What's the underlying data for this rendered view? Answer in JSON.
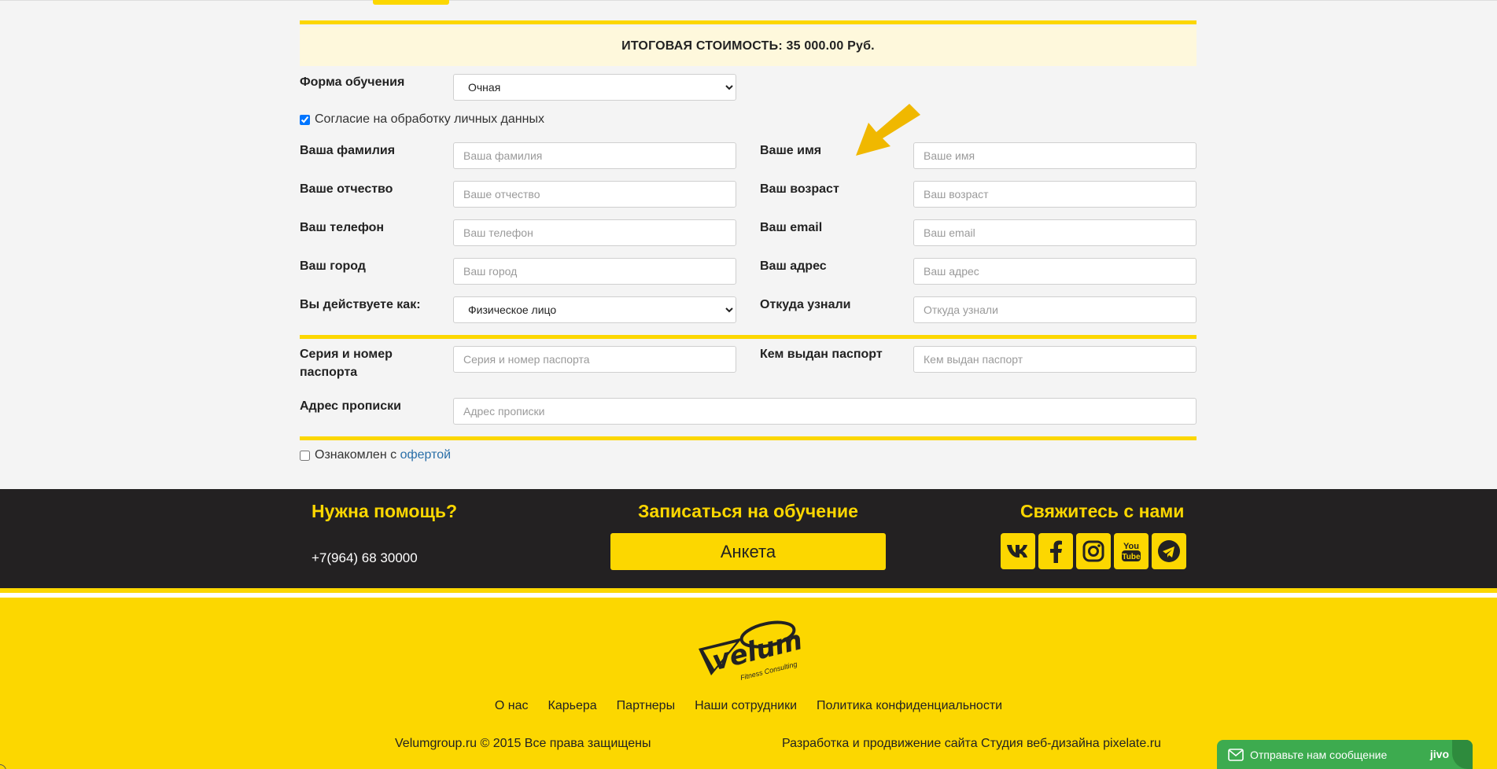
{
  "total": {
    "label": "ИТОГОВАЯ СТОИМОСТЬ: 35 000.00 Руб."
  },
  "form": {
    "study_form": {
      "label": "Форма обучения",
      "value": "Очная"
    },
    "consent": {
      "label": "Согласие на обработку личных данных",
      "checked": true
    },
    "surname": {
      "label": "Ваша фамилия",
      "placeholder": "Ваша фамилия"
    },
    "name": {
      "label": "Ваше имя",
      "placeholder": "Ваше имя"
    },
    "patronymic": {
      "label": "Ваше отчество",
      "placeholder": "Ваше отчество"
    },
    "age": {
      "label": "Ваш возраст",
      "placeholder": "Ваш возраст"
    },
    "phone": {
      "label": "Ваш телефон",
      "placeholder": "Ваш телефон"
    },
    "email": {
      "label": "Ваш email",
      "placeholder": "Ваш email"
    },
    "city": {
      "label": "Ваш город",
      "placeholder": "Ваш город"
    },
    "address": {
      "label": "Ваш адрес",
      "placeholder": "Ваш адрес"
    },
    "acting_as": {
      "label": "Вы действуете как:",
      "value": "Физическое лицо"
    },
    "source": {
      "label": "Откуда узнали",
      "placeholder": "Откуда узнали"
    },
    "passport_number": {
      "label": "Серия и номер паспорта",
      "placeholder": "Серия и номер паспорта"
    },
    "passport_issuer": {
      "label": "Кем выдан паспорт",
      "placeholder": "Кем выдан паспорт"
    },
    "registration": {
      "label": "Адрес прописки",
      "placeholder": "Адрес прописки"
    },
    "offer": {
      "prefix": "Ознакомлен с ",
      "link": "офертой",
      "checked": false
    }
  },
  "footer_dark": {
    "help_title": "Нужна помощь?",
    "phone": "+7(964) 68 30000",
    "signup_title": "Записаться на обучение",
    "anketa_button": "Анкета",
    "contact_title": "Свяжитесь с нами",
    "socials": [
      "vk-icon",
      "facebook-icon",
      "instagram-icon",
      "youtube-icon",
      "telegram-icon"
    ]
  },
  "footer_yellow": {
    "logo_text": "velum",
    "logo_sub": "Fitness Consulting",
    "nav": [
      "О нас",
      "Карьера",
      "Партнеры",
      "Наши сотрудники",
      "Политика конфиденциальности"
    ],
    "copyright": "Velumgroup.ru © 2015 Все права защищены",
    "developer": "Разработка и продвижение сайта Студия веб-дизайна pixelate.ru"
  },
  "chat": {
    "label": "Отправьте нам сообщение",
    "brand": "jivo"
  },
  "colors": {
    "accent": "#fcd700",
    "dark": "#232122",
    "chat": "#3dab4f",
    "arrow": "#f0b800"
  }
}
